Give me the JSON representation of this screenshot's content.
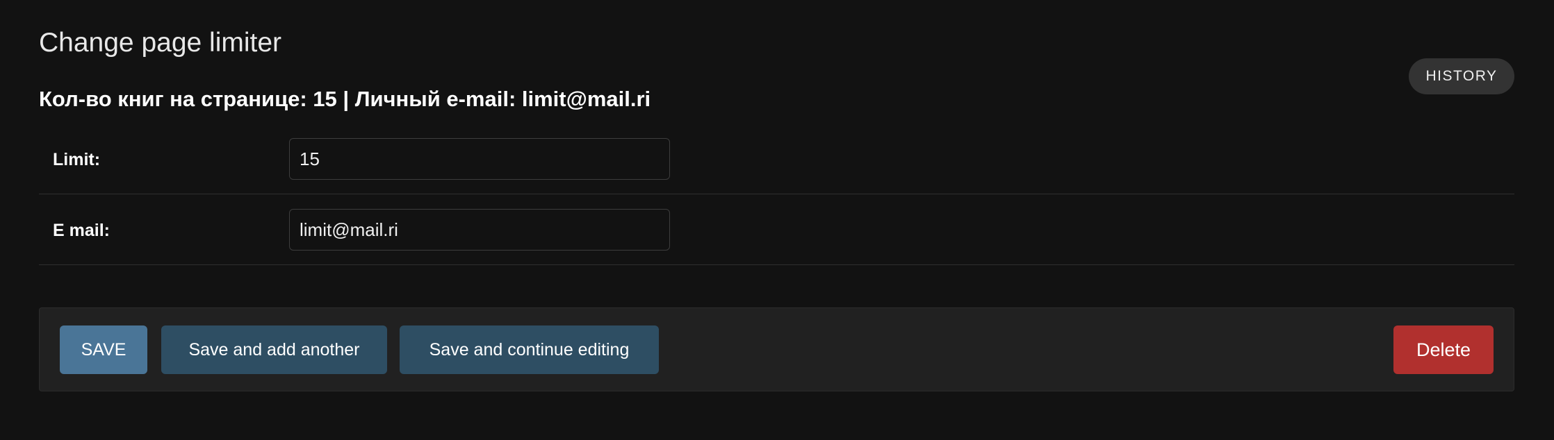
{
  "page": {
    "title": "Change page limiter",
    "object_heading": "Кол-во книг на странице: 15 | Личный e-mail: limit@mail.ri"
  },
  "header": {
    "history_label": "HISTORY"
  },
  "form": {
    "limit": {
      "label": "Limit:",
      "value": "15"
    },
    "email": {
      "label": "E mail:",
      "value": "limit@mail.ri"
    }
  },
  "submit_row": {
    "save_label": "SAVE",
    "save_add_label": "Save and add another",
    "save_continue_label": "Save and continue editing",
    "delete_label": "Delete"
  },
  "colors": {
    "background": "#121212",
    "primary_button": "#4a7597",
    "secondary_button": "#2e4e63",
    "delete_button": "#b1302e"
  }
}
